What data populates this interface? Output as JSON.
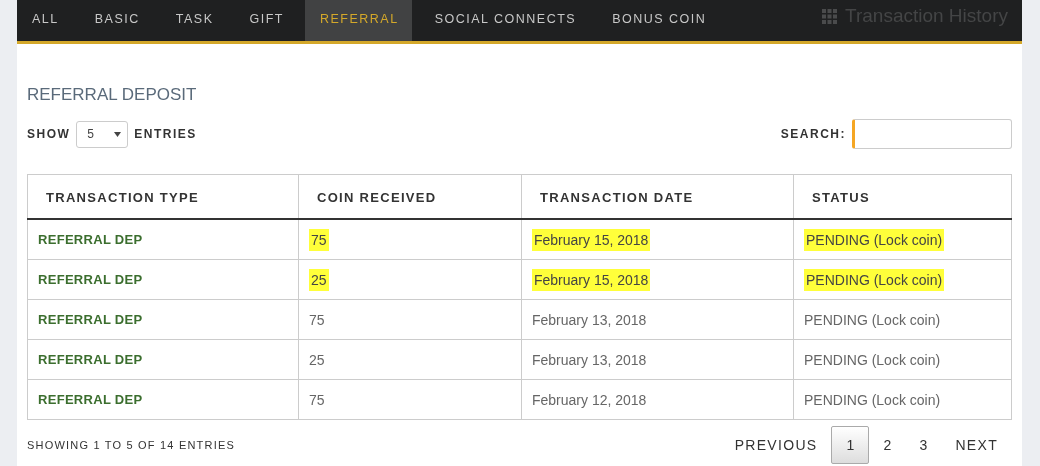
{
  "tabs": [
    {
      "label": "ALL",
      "selected": false
    },
    {
      "label": "BASIC",
      "selected": false
    },
    {
      "label": "TASK",
      "selected": false
    },
    {
      "label": "GIFT",
      "selected": false
    },
    {
      "label": "REFERRAL",
      "selected": true
    },
    {
      "label": "SOCIAL CONNECTS",
      "selected": false
    },
    {
      "label": "BONUS COIN",
      "selected": false
    }
  ],
  "page_title": "Transaction History",
  "section_title": "REFERRAL DEPOSIT",
  "length_control": {
    "before": "SHOW",
    "value": "5",
    "after": "ENTRIES"
  },
  "search": {
    "label": "SEARCH:"
  },
  "table": {
    "columns": [
      "TRANSACTION TYPE",
      "COIN RECEIVED",
      "TRANSACTION DATE",
      "STATUS"
    ],
    "rows": [
      {
        "cells": [
          "REFERRAL DEP",
          "75",
          "February 15, 2018",
          "PENDING (Lock coin)"
        ],
        "highlighted": true
      },
      {
        "cells": [
          "REFERRAL DEP",
          "25",
          "February 15, 2018",
          "PENDING (Lock coin)"
        ],
        "highlighted": true
      },
      {
        "cells": [
          "REFERRAL DEP",
          "75",
          "February 13, 2018",
          "PENDING (Lock coin)"
        ],
        "highlighted": false
      },
      {
        "cells": [
          "REFERRAL DEP",
          "25",
          "February 13, 2018",
          "PENDING (Lock coin)"
        ],
        "highlighted": false
      },
      {
        "cells": [
          "REFERRAL DEP",
          "75",
          "February 12, 2018",
          "PENDING (Lock coin)"
        ],
        "highlighted": false
      }
    ]
  },
  "info": "SHOWING 1 TO 5 OF 14 ENTRIES",
  "pagination": [
    {
      "label": "PREVIOUS",
      "kind": "nav",
      "selected": false
    },
    {
      "label": "1",
      "kind": "page",
      "selected": true
    },
    {
      "label": "2",
      "kind": "page",
      "selected": false
    },
    {
      "label": "3",
      "kind": "page",
      "selected": false
    },
    {
      "label": "NEXT",
      "kind": "nav",
      "selected": false
    }
  ]
}
